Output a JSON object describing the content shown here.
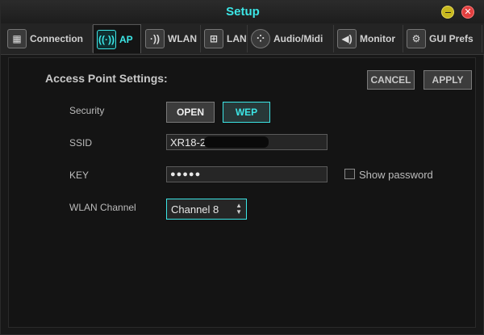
{
  "window": {
    "title": "Setup",
    "close_glyph": "✕"
  },
  "tabs": [
    {
      "label": "Connection",
      "icon": "mixer-icon"
    },
    {
      "label": "AP",
      "icon": "wifi-ap-icon",
      "active": true
    },
    {
      "label": "WLAN",
      "icon": "wlan-icon"
    },
    {
      "label": "LAN",
      "icon": "ethernet-icon"
    },
    {
      "label": "Audio/Midi",
      "icon": "midi-icon"
    },
    {
      "label": "Monitor",
      "icon": "speaker-icon"
    },
    {
      "label": "GUI Prefs",
      "icon": "gears-icon"
    }
  ],
  "ap_settings": {
    "title": "Access Point Settings:",
    "cancel_label": "CANCEL",
    "apply_label": "APPLY",
    "security": {
      "label": "Security",
      "open_label": "OPEN",
      "wep_label": "WEP",
      "selected": "WEP"
    },
    "ssid": {
      "label": "SSID",
      "value": "XR18-2"
    },
    "key": {
      "label": "KEY",
      "value": "●●●●●"
    },
    "show_password": {
      "label": "Show password",
      "checked": false
    },
    "wlan_channel": {
      "label": "WLAN Channel",
      "value": "Channel 8"
    }
  },
  "colors": {
    "accent": "#3ce6e6",
    "background": "#141414"
  }
}
